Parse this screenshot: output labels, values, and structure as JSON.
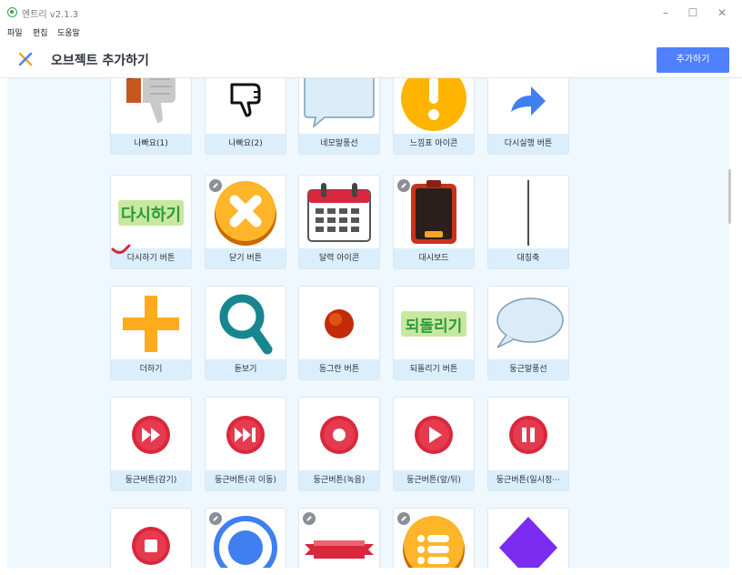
{
  "window": {
    "title": "엔트리 v2.1.3"
  },
  "menu": [
    "파일",
    "편집",
    "도움말"
  ],
  "header": {
    "title": "오브젝트 추가하기",
    "add_button": "추가하기"
  },
  "objects": [
    {
      "label": "나빠요(1)",
      "icon": "thumb-down-photo"
    },
    {
      "label": "나빠요(2)",
      "icon": "thumb-down-outline"
    },
    {
      "label": "네모말풍선",
      "icon": "square-speech-bubble"
    },
    {
      "label": "느낌표 아이콘",
      "icon": "exclamation-icon"
    },
    {
      "label": "다시실행 버튼",
      "icon": "redo-arrow"
    },
    {
      "label": "다시하기 버튼",
      "icon": "retry-text",
      "text": "다시하기"
    },
    {
      "label": "닫기 버튼",
      "icon": "close-x-gold"
    },
    {
      "label": "달력 아이콘",
      "icon": "calendar"
    },
    {
      "label": "대시보드",
      "icon": "dashboard-board"
    },
    {
      "label": "대칭축",
      "icon": "symmetry-line"
    },
    {
      "label": "더하기",
      "icon": "plus-orange"
    },
    {
      "label": "돋보기",
      "icon": "magnifier"
    },
    {
      "label": "동그란 버튼",
      "icon": "round-red-dot"
    },
    {
      "label": "되돌리기 버튼",
      "icon": "undo-text",
      "text": "되돌리기"
    },
    {
      "label": "둥근말풍선",
      "icon": "round-speech-bubble"
    },
    {
      "label": "둥근버튼(감기)",
      "icon": "fast-forward"
    },
    {
      "label": "둥근버튼(곡 이동)",
      "icon": "skip-next"
    },
    {
      "label": "둥근버튼(녹음)",
      "icon": "record"
    },
    {
      "label": "둥근버튼(앞/뒤)",
      "icon": "play"
    },
    {
      "label": "둥근버튼(일시정⋯",
      "icon": "pause"
    },
    {
      "label": "",
      "icon": "stop"
    },
    {
      "label": "",
      "icon": "blue-ring"
    },
    {
      "label": "",
      "icon": "red-ribbon"
    },
    {
      "label": "",
      "icon": "list-menu-gold"
    },
    {
      "label": "",
      "icon": "purple-diamond"
    }
  ],
  "colors": {
    "accent": "#4f80ff",
    "background": "#eef8fe",
    "label_bg": "#dbeefb",
    "red": "#d9273d"
  }
}
